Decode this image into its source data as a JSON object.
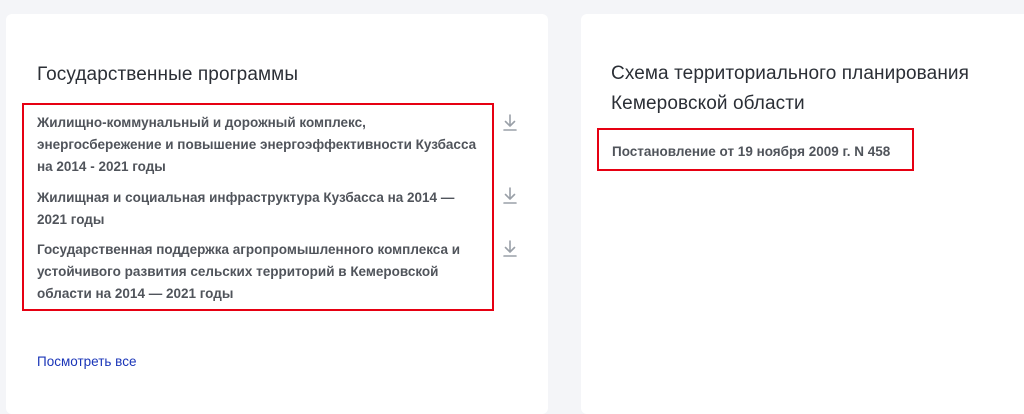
{
  "programs": {
    "title": "Государственные программы",
    "items": [
      {
        "label": "Жилищно-коммунальный и дорожный комплекс, энергосбережение и повышение энергоэффективности Кузбасса на 2014 - 2021 годы",
        "icon": "download-icon"
      },
      {
        "label": "Жилищная и социальная инфраструктура Кузбасса на 2014 — 2021 годы",
        "icon": "download-icon"
      },
      {
        "label": "Государственная поддержка агропромышленного комплекса и устойчивого развития сельских территорий в Кемеровской области на 2014 — 2021 годы",
        "icon": "download-icon"
      }
    ],
    "view_all": "Посмотреть все"
  },
  "scheme": {
    "title": "Схема территориального планирования Кемеровской области",
    "resolution": "Постановление от 19 ноября 2009 г. N 458"
  },
  "colors": {
    "background": "#f4f5f8",
    "card": "#ffffff",
    "highlight": "#e60012",
    "link": "#1a35b8",
    "text": "#50545b",
    "title": "#2b2f36"
  }
}
